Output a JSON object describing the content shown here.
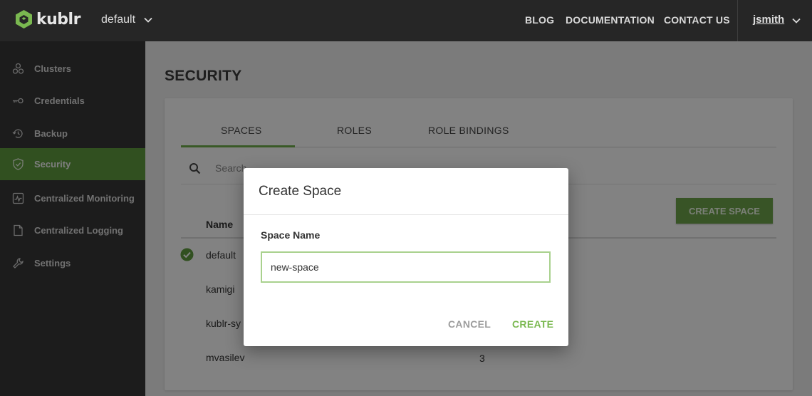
{
  "header": {
    "logo_text": "kublr",
    "space_selector": "default",
    "nav": [
      "BLOG",
      "DOCUMENTATION",
      "CONTACT US"
    ],
    "user": "jsmith"
  },
  "sidebar": {
    "items": [
      {
        "label": "Clusters",
        "icon": "clusters-icon"
      },
      {
        "label": "Credentials",
        "icon": "key-icon"
      },
      {
        "label": "Backup",
        "icon": "backup-icon"
      },
      {
        "label": "Security",
        "icon": "shield-icon",
        "active": true
      },
      {
        "label": "Centralized Monitoring",
        "icon": "monitoring-icon"
      },
      {
        "label": "Centralized Logging",
        "icon": "document-icon"
      },
      {
        "label": "Settings",
        "icon": "wrench-icon"
      }
    ]
  },
  "main": {
    "title": "SECURITY",
    "tabs": [
      "SPACES",
      "ROLES",
      "ROLE BINDINGS"
    ],
    "active_tab": "SPACES",
    "search_placeholder": "Search",
    "create_button": "CREATE SPACE",
    "table": {
      "columns": [
        "Name"
      ],
      "rows": [
        {
          "name": "default",
          "selected": true
        },
        {
          "name": "kamigi"
        },
        {
          "name": "kublr-sy"
        },
        {
          "name": "mvasilev",
          "value": "3"
        }
      ]
    }
  },
  "dialog": {
    "title": "Create Space",
    "field_label": "Space Name",
    "field_value": "new-space",
    "cancel_label": "CANCEL",
    "create_label": "CREATE"
  },
  "colors": {
    "accent": "#6ca24a",
    "topbar": "#262626",
    "sidebar": "#363636"
  }
}
